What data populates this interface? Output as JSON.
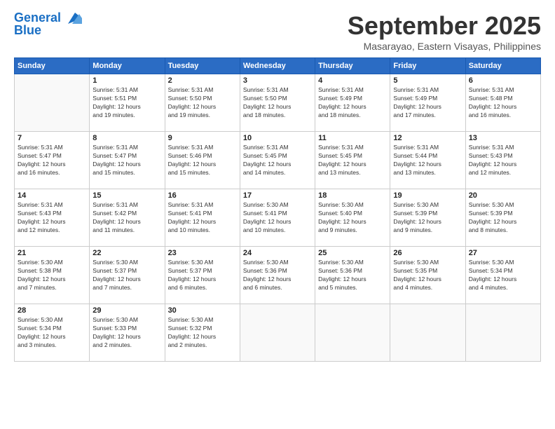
{
  "header": {
    "logo_line1": "General",
    "logo_line2": "Blue",
    "month": "September 2025",
    "location": "Masarayao, Eastern Visayas, Philippines"
  },
  "weekdays": [
    "Sunday",
    "Monday",
    "Tuesday",
    "Wednesday",
    "Thursday",
    "Friday",
    "Saturday"
  ],
  "weeks": [
    [
      {
        "day": "",
        "info": ""
      },
      {
        "day": "1",
        "info": "Sunrise: 5:31 AM\nSunset: 5:51 PM\nDaylight: 12 hours\nand 19 minutes."
      },
      {
        "day": "2",
        "info": "Sunrise: 5:31 AM\nSunset: 5:50 PM\nDaylight: 12 hours\nand 19 minutes."
      },
      {
        "day": "3",
        "info": "Sunrise: 5:31 AM\nSunset: 5:50 PM\nDaylight: 12 hours\nand 18 minutes."
      },
      {
        "day": "4",
        "info": "Sunrise: 5:31 AM\nSunset: 5:49 PM\nDaylight: 12 hours\nand 18 minutes."
      },
      {
        "day": "5",
        "info": "Sunrise: 5:31 AM\nSunset: 5:49 PM\nDaylight: 12 hours\nand 17 minutes."
      },
      {
        "day": "6",
        "info": "Sunrise: 5:31 AM\nSunset: 5:48 PM\nDaylight: 12 hours\nand 16 minutes."
      }
    ],
    [
      {
        "day": "7",
        "info": "Sunrise: 5:31 AM\nSunset: 5:47 PM\nDaylight: 12 hours\nand 16 minutes."
      },
      {
        "day": "8",
        "info": "Sunrise: 5:31 AM\nSunset: 5:47 PM\nDaylight: 12 hours\nand 15 minutes."
      },
      {
        "day": "9",
        "info": "Sunrise: 5:31 AM\nSunset: 5:46 PM\nDaylight: 12 hours\nand 15 minutes."
      },
      {
        "day": "10",
        "info": "Sunrise: 5:31 AM\nSunset: 5:45 PM\nDaylight: 12 hours\nand 14 minutes."
      },
      {
        "day": "11",
        "info": "Sunrise: 5:31 AM\nSunset: 5:45 PM\nDaylight: 12 hours\nand 13 minutes."
      },
      {
        "day": "12",
        "info": "Sunrise: 5:31 AM\nSunset: 5:44 PM\nDaylight: 12 hours\nand 13 minutes."
      },
      {
        "day": "13",
        "info": "Sunrise: 5:31 AM\nSunset: 5:43 PM\nDaylight: 12 hours\nand 12 minutes."
      }
    ],
    [
      {
        "day": "14",
        "info": "Sunrise: 5:31 AM\nSunset: 5:43 PM\nDaylight: 12 hours\nand 12 minutes."
      },
      {
        "day": "15",
        "info": "Sunrise: 5:31 AM\nSunset: 5:42 PM\nDaylight: 12 hours\nand 11 minutes."
      },
      {
        "day": "16",
        "info": "Sunrise: 5:31 AM\nSunset: 5:41 PM\nDaylight: 12 hours\nand 10 minutes."
      },
      {
        "day": "17",
        "info": "Sunrise: 5:30 AM\nSunset: 5:41 PM\nDaylight: 12 hours\nand 10 minutes."
      },
      {
        "day": "18",
        "info": "Sunrise: 5:30 AM\nSunset: 5:40 PM\nDaylight: 12 hours\nand 9 minutes."
      },
      {
        "day": "19",
        "info": "Sunrise: 5:30 AM\nSunset: 5:39 PM\nDaylight: 12 hours\nand 9 minutes."
      },
      {
        "day": "20",
        "info": "Sunrise: 5:30 AM\nSunset: 5:39 PM\nDaylight: 12 hours\nand 8 minutes."
      }
    ],
    [
      {
        "day": "21",
        "info": "Sunrise: 5:30 AM\nSunset: 5:38 PM\nDaylight: 12 hours\nand 7 minutes."
      },
      {
        "day": "22",
        "info": "Sunrise: 5:30 AM\nSunset: 5:37 PM\nDaylight: 12 hours\nand 7 minutes."
      },
      {
        "day": "23",
        "info": "Sunrise: 5:30 AM\nSunset: 5:37 PM\nDaylight: 12 hours\nand 6 minutes."
      },
      {
        "day": "24",
        "info": "Sunrise: 5:30 AM\nSunset: 5:36 PM\nDaylight: 12 hours\nand 6 minutes."
      },
      {
        "day": "25",
        "info": "Sunrise: 5:30 AM\nSunset: 5:36 PM\nDaylight: 12 hours\nand 5 minutes."
      },
      {
        "day": "26",
        "info": "Sunrise: 5:30 AM\nSunset: 5:35 PM\nDaylight: 12 hours\nand 4 minutes."
      },
      {
        "day": "27",
        "info": "Sunrise: 5:30 AM\nSunset: 5:34 PM\nDaylight: 12 hours\nand 4 minutes."
      }
    ],
    [
      {
        "day": "28",
        "info": "Sunrise: 5:30 AM\nSunset: 5:34 PM\nDaylight: 12 hours\nand 3 minutes."
      },
      {
        "day": "29",
        "info": "Sunrise: 5:30 AM\nSunset: 5:33 PM\nDaylight: 12 hours\nand 2 minutes."
      },
      {
        "day": "30",
        "info": "Sunrise: 5:30 AM\nSunset: 5:32 PM\nDaylight: 12 hours\nand 2 minutes."
      },
      {
        "day": "",
        "info": ""
      },
      {
        "day": "",
        "info": ""
      },
      {
        "day": "",
        "info": ""
      },
      {
        "day": "",
        "info": ""
      }
    ]
  ]
}
